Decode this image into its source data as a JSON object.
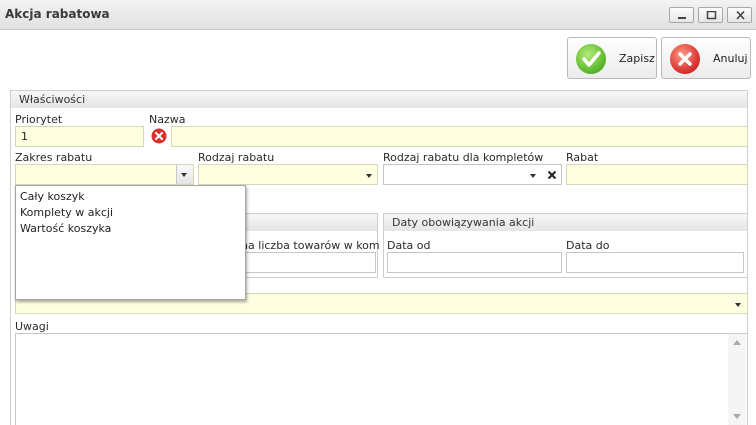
{
  "window": {
    "title": "Akcja rabatowa"
  },
  "toolbar": {
    "save_label": "Zapisz",
    "cancel_label": "Anuluj"
  },
  "properties": {
    "header": "Właściwości",
    "priority_label": "Priorytet",
    "priority_value": "1",
    "name_label": "Nazwa",
    "name_value": "",
    "scope_label": "Zakres rabatu",
    "type_label": "Rodzaj rabatu",
    "set_type_label": "Rodzaj rabatu dla kompletów",
    "discount_label": "Rabat"
  },
  "scope_dropdown": {
    "options": [
      "Cały koszyk",
      "Komplety w akcji",
      "Wartość koszyka"
    ]
  },
  "min_items_label": "lna liczba towarów w kom",
  "dates": {
    "header": "Daty obowiązywania akcji",
    "from_label": "Data od",
    "to_label": "Data do"
  },
  "notes": {
    "label": "Uwagi"
  },
  "colors": {
    "required_field": "#fefee0",
    "accent_green": "#5db82e",
    "accent_red": "#d9322e"
  }
}
